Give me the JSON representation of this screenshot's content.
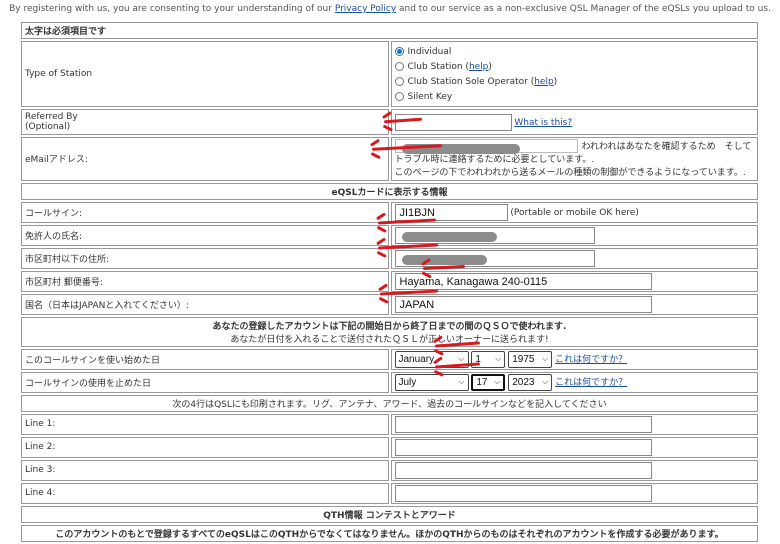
{
  "notice": {
    "before": "By registering with us, you are consenting to your understanding of our ",
    "privacy_link": "Privacy Policy",
    "after": " and to our service as a non-exclusive QSL Manager of the eQSLs you upload to us."
  },
  "required_note": "太字は必須項目です",
  "station": {
    "label": "Type of Station",
    "options": [
      {
        "label": "Individual",
        "selected": true
      },
      {
        "label": "Club Station",
        "help": "help"
      },
      {
        "label": "Club Station Sole Operator",
        "help": "help"
      },
      {
        "label": "Silent Key"
      }
    ]
  },
  "referred": {
    "label_line1": "Referred By",
    "label_line2": "(Optional)",
    "link": "What is this?"
  },
  "email": {
    "label": "eMailアドレス:",
    "note1": "われわれはあなたを確認するため　そして　トラブル時に連絡するために必要としています。.",
    "note2": "このページの下でわれわれから送るメールの種類の制御ができるようになっています。."
  },
  "card_header": "eQSLカードに表示する情報",
  "callsign": {
    "label": "コールサイン:",
    "value": "JI1BJN",
    "note": "(Portable or mobile OK here)"
  },
  "name_label": "免許人の氏名:",
  "address_label": "市区町村以下の住所:",
  "postal": {
    "label": "市区町村 郵便番号:",
    "value": "Hayama, Kanagawa 240-0115"
  },
  "country": {
    "label": "国名（日本はJAPANと入れてください）:",
    "value": "JAPAN"
  },
  "period_note": {
    "line1": "あなたの登録したアカウントは下記の開始日から終了日までの間のＱＳＯで使われます.",
    "line2": "あなたが日付を入れることで送付されたＱＳＬが正しいオーナーに送られます!"
  },
  "start": {
    "label": "このコールサインを使い始めた日",
    "month": "January",
    "day": "1",
    "year": "1975",
    "help": "これは何ですか？"
  },
  "end": {
    "label": "コールサインの使用を止めた日",
    "month": "July",
    "day": "17",
    "year": "2023",
    "help": "これは何ですか？"
  },
  "print_note": "次の4行はQSLにも印刷されます。リグ、アンテナ、アワード、過去のコールサインなどを記入してください",
  "lines": [
    {
      "label": "Line 1:"
    },
    {
      "label": "Line 2:"
    },
    {
      "label": "Line 3:"
    },
    {
      "label": "Line 4:"
    }
  ],
  "qth_header": "QTH情報 コンテストとアワード",
  "qth_note": "このアカウントのもとで登録するすべてのeQSLはこのQTHからでなくてはなりません。ほかのQTHからのものはそれぞれのアカウントを作成する必要があります。",
  "colors": {
    "arrow": "#d71920",
    "link": "#1a4fa0",
    "radio_selected": "#1a6fd6"
  }
}
